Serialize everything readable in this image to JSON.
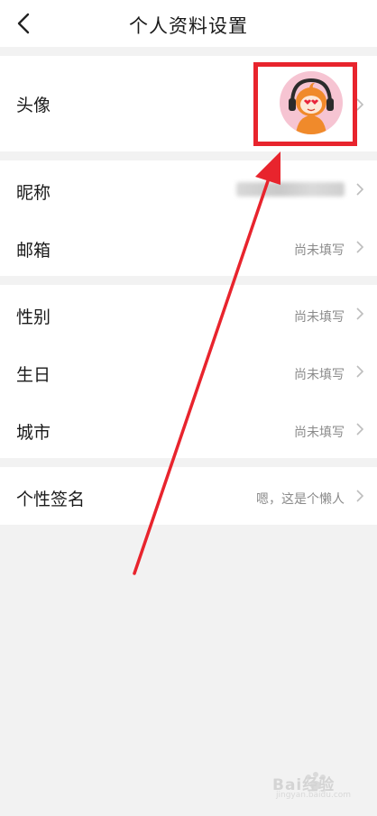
{
  "header": {
    "title": "个人资料设置"
  },
  "rows": {
    "avatar": {
      "label": "头像"
    },
    "nickname": {
      "label": "昵称"
    },
    "email": {
      "label": "邮箱",
      "value": "尚未填写"
    },
    "gender": {
      "label": "性别",
      "value": "尚未填写"
    },
    "birthday": {
      "label": "生日",
      "value": "尚未填写"
    },
    "city": {
      "label": "城市",
      "value": "尚未填写"
    },
    "signature": {
      "label": "个性签名",
      "value": "嗯，这是个懒人"
    }
  },
  "annotation": {
    "color": "#e8242d"
  },
  "watermark": {
    "brand": "Bai经验",
    "site": "jingyan.baidu.com"
  },
  "icons": [
    "back-arrow-icon",
    "chevron-right-icon",
    "avatar-mascot"
  ]
}
